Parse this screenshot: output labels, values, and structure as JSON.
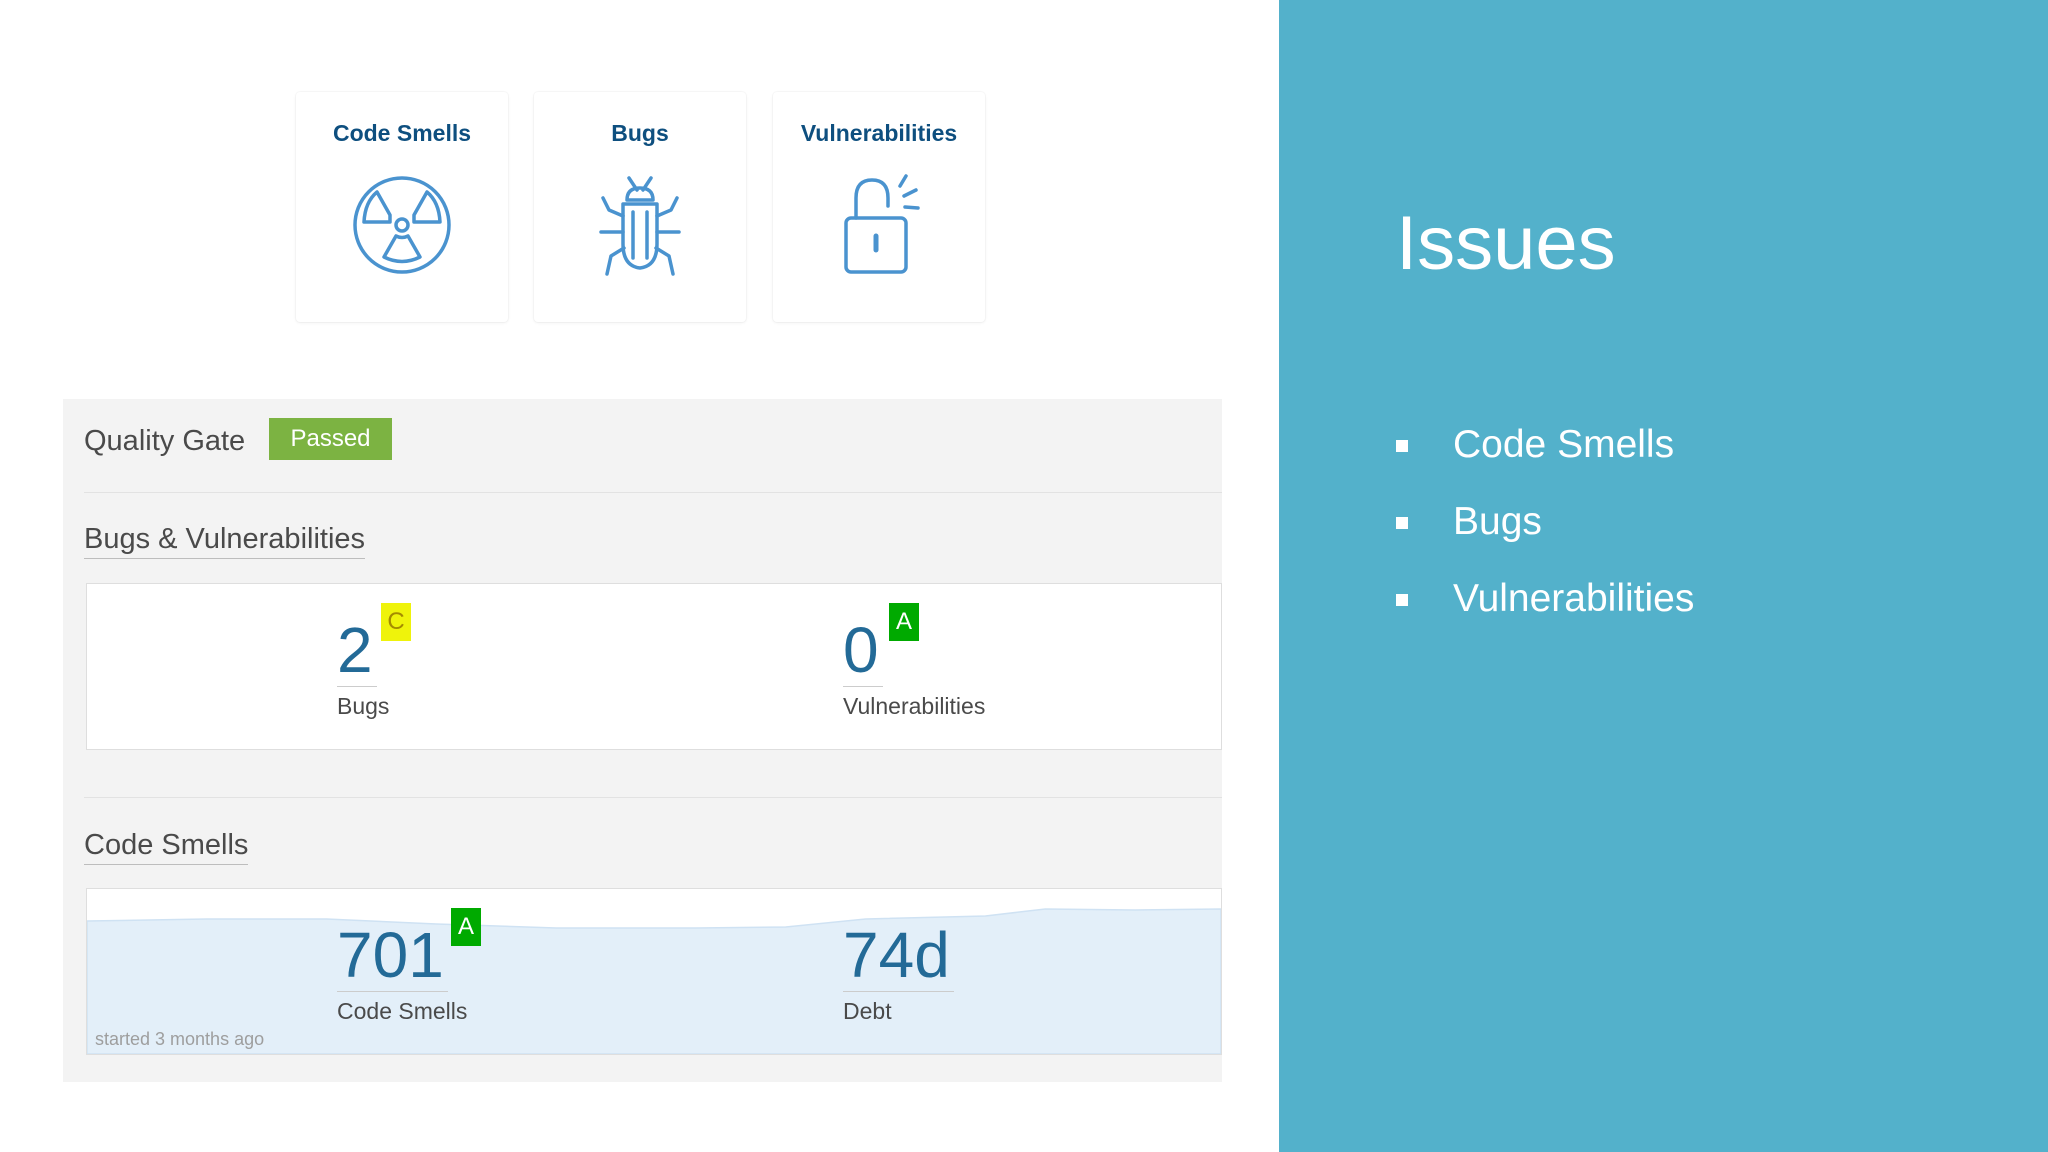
{
  "issue_types": {
    "code_smells": {
      "title": "Code Smells",
      "icon": "radiation-icon"
    },
    "bugs": {
      "title": "Bugs",
      "icon": "bug-icon"
    },
    "vulnerabilities": {
      "title": "Vulnerabilities",
      "icon": "open-lock-icon"
    }
  },
  "dashboard": {
    "quality_gate": {
      "label": "Quality Gate",
      "status": "Passed",
      "status_color": "#7cb342"
    },
    "bugs_vulns": {
      "title": "Bugs & Vulnerabilities",
      "bugs": {
        "value": "2",
        "label": "Bugs",
        "rating": "C"
      },
      "vulnerabilities": {
        "value": "0",
        "label": "Vulnerabilities",
        "rating": "A"
      }
    },
    "code_smells": {
      "title": "Code Smells",
      "smells": {
        "value": "701",
        "label": "Code Smells",
        "rating": "A"
      },
      "debt": {
        "value": "74d",
        "label": "Debt"
      },
      "history_note": "started 3 months ago"
    }
  },
  "slide": {
    "title": "Issues",
    "bullets": [
      "Code Smells",
      "Bugs",
      "Vulnerabilities"
    ],
    "background": "#53b1cb"
  },
  "colors": {
    "rating_a": "#00aa00",
    "rating_c": "#eff30b",
    "measure_value": "#236a97",
    "card_title": "#0e4f7f",
    "icon_stroke": "#4a93cf"
  }
}
